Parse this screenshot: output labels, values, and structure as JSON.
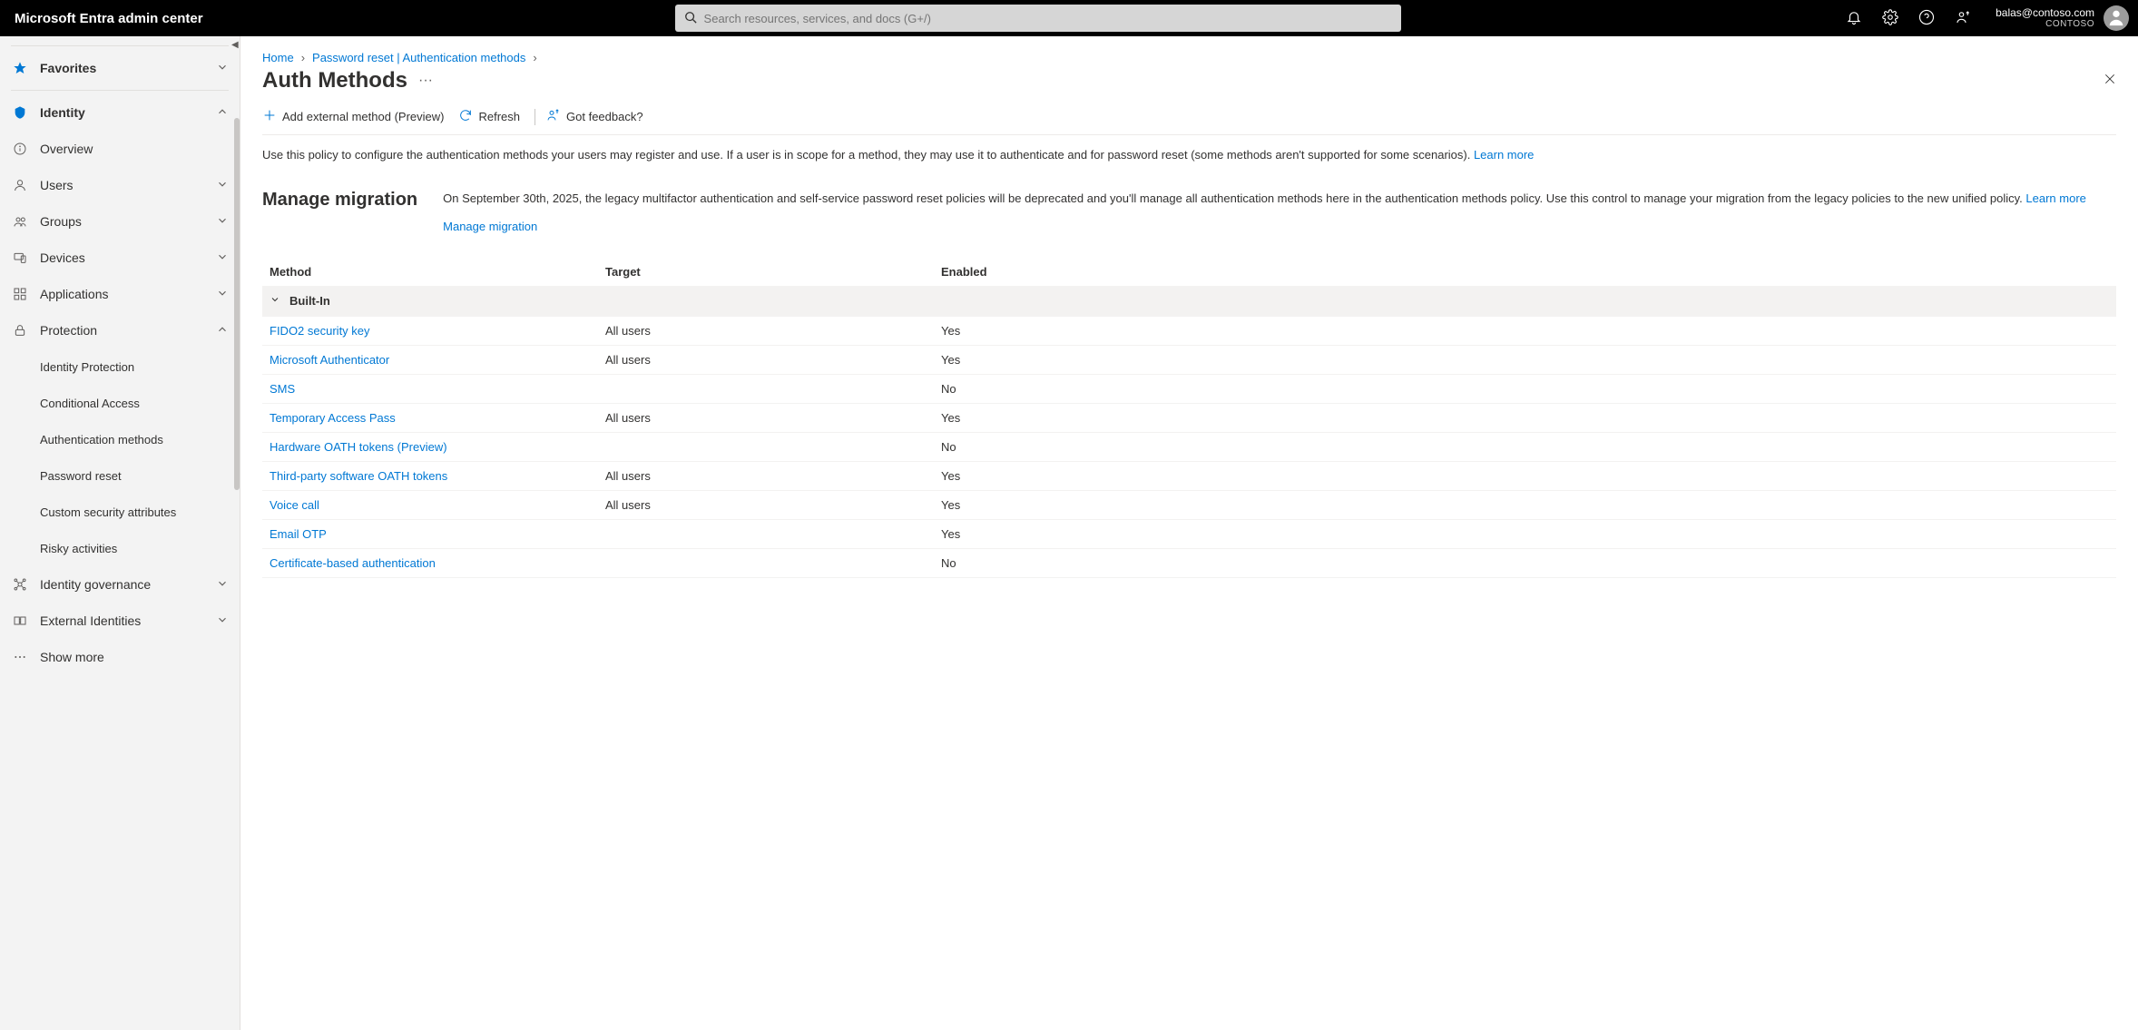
{
  "header": {
    "title": "Microsoft Entra admin center",
    "search_placeholder": "Search resources, services, and docs (G+/)",
    "user_email": "balas@contoso.com",
    "user_org": "CONTOSO"
  },
  "sidebar": {
    "favorites": "Favorites",
    "identity": "Identity",
    "items": [
      {
        "label": "Overview"
      },
      {
        "label": "Users"
      },
      {
        "label": "Groups"
      },
      {
        "label": "Devices"
      },
      {
        "label": "Applications"
      },
      {
        "label": "Protection"
      }
    ],
    "protection_sub": [
      {
        "label": "Identity Protection"
      },
      {
        "label": "Conditional Access"
      },
      {
        "label": "Authentication methods"
      },
      {
        "label": "Password reset"
      },
      {
        "label": "Custom security attributes"
      },
      {
        "label": "Risky activities"
      }
    ],
    "identity_governance": "Identity governance",
    "external_identities": "External Identities",
    "show_more": "Show more"
  },
  "breadcrumb": {
    "home": "Home",
    "pwr": "Password reset | Authentication methods"
  },
  "page": {
    "title": "Auth Methods"
  },
  "commands": {
    "add": "Add external method (Preview)",
    "refresh": "Refresh",
    "feedback": "Got feedback?"
  },
  "description": {
    "text": "Use this policy to configure the authentication methods your users may register and use. If a user is in scope for a method, they may use it to authenticate and for password reset (some methods aren't supported for some scenarios). ",
    "learn_more": "Learn more"
  },
  "migration": {
    "title": "Manage migration",
    "text": "On September 30th, 2025, the legacy multifactor authentication and self-service password reset policies will be deprecated and you'll manage all authentication methods here in the authentication methods policy. Use this control to manage your migration from the legacy policies to the new unified policy. ",
    "learn_more": "Learn more",
    "link": "Manage migration"
  },
  "table": {
    "headers": {
      "method": "Method",
      "target": "Target",
      "enabled": "Enabled"
    },
    "group": "Built-In",
    "rows": [
      {
        "method": "FIDO2 security key",
        "target": "All users",
        "enabled": "Yes"
      },
      {
        "method": "Microsoft Authenticator",
        "target": "All users",
        "enabled": "Yes"
      },
      {
        "method": "SMS",
        "target": "",
        "enabled": "No"
      },
      {
        "method": "Temporary Access Pass",
        "target": "All users",
        "enabled": "Yes"
      },
      {
        "method": "Hardware OATH tokens (Preview)",
        "target": "",
        "enabled": "No"
      },
      {
        "method": "Third-party software OATH tokens",
        "target": "All users",
        "enabled": "Yes"
      },
      {
        "method": "Voice call",
        "target": "All users",
        "enabled": "Yes"
      },
      {
        "method": "Email OTP",
        "target": "",
        "enabled": "Yes"
      },
      {
        "method": "Certificate-based authentication",
        "target": "",
        "enabled": "No"
      }
    ]
  }
}
